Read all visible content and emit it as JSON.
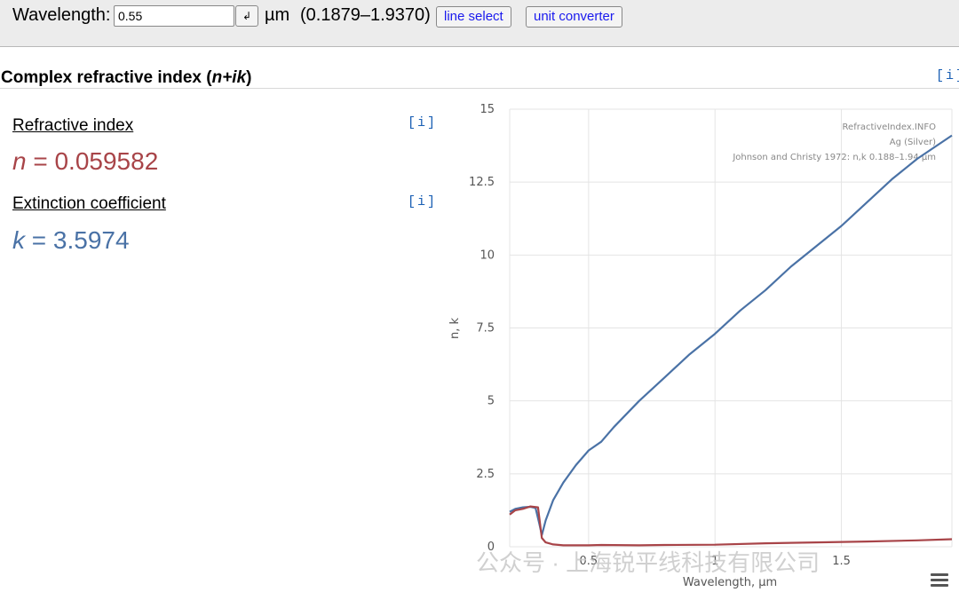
{
  "toolbar": {
    "wavelength_label": "Wavelength:",
    "wavelength_value": "0.55",
    "enter_glyph": "↲",
    "unit": "µm",
    "range": "(0.1879–1.9370)",
    "line_select_label": "line select",
    "unit_converter_label": "unit converter"
  },
  "section": {
    "title_main": "Complex refractive index (",
    "title_var": "n+ik",
    "title_end": ")",
    "info": "[i]"
  },
  "refractive": {
    "label": "Refractive index",
    "symbol": "n",
    "eq": " = 0.059582",
    "info": "[i]"
  },
  "extinction": {
    "label": "Extinction coefficient",
    "symbol": "k",
    "eq": " = 3.5974",
    "info": "[i]"
  },
  "chart_data": {
    "type": "line",
    "xlabel": "Wavelength, µm",
    "ylabel": "n, k",
    "xlim": [
      0.1879,
      1.937
    ],
    "ylim": [
      0,
      15
    ],
    "x_ticks": [
      "0.5",
      "1",
      "1.5"
    ],
    "y_ticks": [
      "0",
      "2.5",
      "5",
      "7.5",
      "10",
      "12.5",
      "15"
    ],
    "grid": true,
    "annotations": [
      "RefractiveIndex.INFO",
      "Ag (Silver)",
      "Johnson and Christy 1972: n,k 0.188–1.94 µm"
    ],
    "series": [
      {
        "name": "k",
        "color": "#4a72a6",
        "points": [
          [
            0.188,
            1.2
          ],
          [
            0.21,
            1.3
          ],
          [
            0.24,
            1.35
          ],
          [
            0.27,
            1.37
          ],
          [
            0.29,
            1.33
          ],
          [
            0.305,
            0.8
          ],
          [
            0.315,
            0.4
          ],
          [
            0.33,
            0.9
          ],
          [
            0.36,
            1.6
          ],
          [
            0.4,
            2.2
          ],
          [
            0.45,
            2.8
          ],
          [
            0.5,
            3.3
          ],
          [
            0.55,
            3.6
          ],
          [
            0.6,
            4.1
          ],
          [
            0.7,
            5.0
          ],
          [
            0.8,
            5.8
          ],
          [
            0.9,
            6.6
          ],
          [
            1.0,
            7.3
          ],
          [
            1.1,
            8.1
          ],
          [
            1.2,
            8.8
          ],
          [
            1.3,
            9.6
          ],
          [
            1.4,
            10.3
          ],
          [
            1.5,
            11.0
          ],
          [
            1.6,
            11.8
          ],
          [
            1.7,
            12.6
          ],
          [
            1.8,
            13.3
          ],
          [
            1.937,
            14.1
          ]
        ]
      },
      {
        "name": "n",
        "color": "#a84448",
        "points": [
          [
            0.188,
            1.1
          ],
          [
            0.21,
            1.25
          ],
          [
            0.24,
            1.3
          ],
          [
            0.27,
            1.38
          ],
          [
            0.3,
            1.35
          ],
          [
            0.315,
            0.3
          ],
          [
            0.33,
            0.15
          ],
          [
            0.36,
            0.08
          ],
          [
            0.4,
            0.05
          ],
          [
            0.5,
            0.05
          ],
          [
            0.55,
            0.06
          ],
          [
            0.7,
            0.05
          ],
          [
            0.8,
            0.06
          ],
          [
            1.0,
            0.07
          ],
          [
            1.2,
            0.12
          ],
          [
            1.4,
            0.15
          ],
          [
            1.6,
            0.18
          ],
          [
            1.8,
            0.22
          ],
          [
            1.937,
            0.26
          ]
        ]
      }
    ]
  },
  "watermark": "公众号 · 上海锐平线科技有限公司"
}
